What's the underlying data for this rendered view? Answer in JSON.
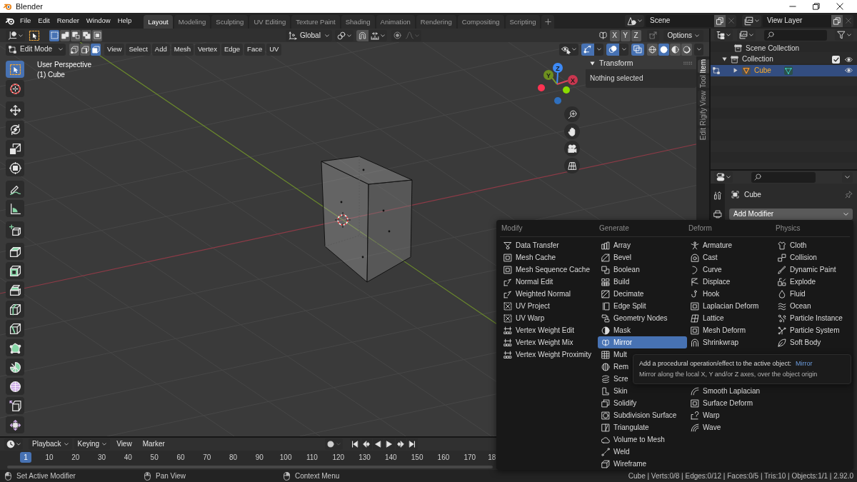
{
  "window": {
    "title": "Blender"
  },
  "top_bar": {
    "menus": [
      "File",
      "Edit",
      "Render",
      "Window",
      "Help"
    ],
    "workspaces": [
      {
        "label": "Layout",
        "selected": true
      },
      {
        "label": "Modeling",
        "selected": false
      },
      {
        "label": "Sculpting",
        "selected": false
      },
      {
        "label": "UV Editing",
        "selected": false
      },
      {
        "label": "Texture Paint",
        "selected": false
      },
      {
        "label": "Shading",
        "selected": false
      },
      {
        "label": "Animation",
        "selected": false
      },
      {
        "label": "Rendering",
        "selected": false
      },
      {
        "label": "Compositing",
        "selected": false
      },
      {
        "label": "Scripting",
        "selected": false
      }
    ],
    "scene": "Scene",
    "view_layer": "View Layer"
  },
  "viewport": {
    "select_modes": [
      {
        "kind": "set",
        "selected": true
      },
      {
        "kind": "extend",
        "selected": false
      },
      {
        "kind": "subtract",
        "selected": false
      },
      {
        "kind": "difference",
        "selected": false
      },
      {
        "kind": "intersect",
        "selected": false
      }
    ],
    "orientation": "Global",
    "mirror_axes": [
      {
        "label": "X",
        "selected": false
      },
      {
        "label": "Y",
        "selected": false
      },
      {
        "label": "Z",
        "selected": false
      }
    ],
    "options": "Options",
    "mode": "Edit Mode",
    "element_modes": [
      {
        "kind": "vertex",
        "selected": false
      },
      {
        "kind": "edge",
        "selected": false
      },
      {
        "kind": "face",
        "selected": true
      }
    ],
    "menus": [
      "View",
      "Select",
      "Add",
      "Mesh",
      "Vertex",
      "Edge",
      "Face",
      "UV"
    ],
    "display_toggles": [
      {
        "kind": "gizmo",
        "on": true
      },
      {
        "kind": "overlay",
        "on": true
      },
      {
        "kind": "xray",
        "on": true
      }
    ],
    "shading_modes": [
      {
        "kind": "wireframe",
        "selected": false
      },
      {
        "kind": "solid",
        "selected": true
      },
      {
        "kind": "material",
        "selected": false
      },
      {
        "kind": "rendered",
        "selected": false
      }
    ],
    "view_name": "User Perspective",
    "object_label": "(1) Cube",
    "tool_groups": [
      [
        {
          "kind": "select",
          "selected": true
        },
        {
          "kind": "cursor",
          "selected": false
        }
      ],
      [
        {
          "kind": "move",
          "selected": false
        },
        {
          "kind": "rotate",
          "selected": false
        },
        {
          "kind": "scale",
          "selected": false
        },
        {
          "kind": "transform",
          "selected": false
        }
      ],
      [
        {
          "kind": "annotate",
          "selected": false
        },
        {
          "kind": "measure",
          "selected": false
        }
      ],
      [
        {
          "kind": "addcube",
          "selected": false
        }
      ],
      [
        {
          "kind": "extrude",
          "selected": false
        },
        {
          "kind": "inset",
          "selected": false
        },
        {
          "kind": "bevel",
          "selected": false
        },
        {
          "kind": "loopcut",
          "selected": false
        },
        {
          "kind": "knife",
          "selected": false
        },
        {
          "kind": "polybuild",
          "selected": false
        },
        {
          "kind": "spin",
          "selected": false
        },
        {
          "kind": "smooth",
          "selected": false
        },
        {
          "kind": "slide",
          "selected": false
        },
        {
          "kind": "shrink",
          "selected": false
        }
      ]
    ],
    "navigation_gizmo": {
      "x": "X",
      "y": "Y",
      "z": "Z"
    },
    "sidebar": {
      "panel": {
        "title": "Transform",
        "expanded": true,
        "text": "Nothing selected"
      },
      "tabs": [
        {
          "label": "Item",
          "selected": true
        },
        {
          "label": "Tool",
          "selected": false
        },
        {
          "label": "View",
          "selected": false
        },
        {
          "label": "Rigify",
          "selected": false
        },
        {
          "label": "Edit",
          "selected": false
        }
      ]
    }
  },
  "outliner": {
    "tree": [
      {
        "label": "Scene Collection",
        "kind": "scene",
        "selected": false,
        "children": [
          {
            "label": "Collection",
            "kind": "collection",
            "selected": false,
            "expanded": true,
            "checked": true,
            "children": [
              {
                "label": "Cube",
                "kind": "object",
                "selected": true,
                "expanded": false
              }
            ]
          }
        ]
      }
    ]
  },
  "properties": {
    "object_name": "Cube",
    "add_modifier": "Add Modifier"
  },
  "modifier_menu": {
    "columns": [
      {
        "header": "Modify",
        "items": [
          {
            "label": "Data Transfer",
            "kind": "transfer",
            "selected": false
          },
          {
            "label": "Mesh Cache",
            "kind": "frame",
            "selected": false
          },
          {
            "label": "Mesh Sequence Cache",
            "kind": "frame",
            "selected": false
          },
          {
            "label": "Normal Edit",
            "kind": "normal",
            "selected": false
          },
          {
            "label": "Weighted Normal",
            "kind": "normal",
            "selected": false
          },
          {
            "label": "UV Project",
            "kind": "uv",
            "selected": false
          },
          {
            "label": "UV Warp",
            "kind": "uv",
            "selected": false
          },
          {
            "label": "Vertex Weight Edit",
            "kind": "weight",
            "selected": false
          },
          {
            "label": "Vertex Weight Mix",
            "kind": "weight",
            "selected": false
          },
          {
            "label": "Vertex Weight Proximity",
            "kind": "weight",
            "selected": false
          }
        ]
      },
      {
        "header": "Generate",
        "items": [
          {
            "label": "Array",
            "kind": "array",
            "selected": false
          },
          {
            "label": "Bevel",
            "kind": "bevel",
            "selected": false
          },
          {
            "label": "Boolean",
            "kind": "boolean",
            "selected": false
          },
          {
            "label": "Build",
            "kind": "build",
            "selected": false
          },
          {
            "label": "Decimate",
            "kind": "decimate",
            "selected": false
          },
          {
            "label": "Edge Split",
            "kind": "split",
            "selected": false
          },
          {
            "label": "Geometry Nodes",
            "kind": "nodes",
            "selected": false
          },
          {
            "label": "Mask",
            "kind": "mask",
            "selected": false
          },
          {
            "label": "Mirror",
            "kind": "mirror",
            "selected": true
          },
          {
            "label": "Mult",
            "kind": "multires",
            "selected": false
          },
          {
            "label": "Rem",
            "kind": "remesh",
            "selected": false
          },
          {
            "label": "Scre",
            "kind": "screw",
            "selected": false
          },
          {
            "label": "Skin",
            "kind": "skin",
            "selected": false
          },
          {
            "label": "Solidify",
            "kind": "solidify",
            "selected": false
          },
          {
            "label": "Subdivision Surface",
            "kind": "subdivision",
            "selected": false
          },
          {
            "label": "Triangulate",
            "kind": "triangulate",
            "selected": false
          },
          {
            "label": "Volume to Mesh",
            "kind": "volume",
            "selected": false
          },
          {
            "label": "Weld",
            "kind": "weld",
            "selected": false
          },
          {
            "label": "Wireframe",
            "kind": "wireframe",
            "selected": false
          }
        ]
      },
      {
        "header": "Deform",
        "items": [
          {
            "label": "Armature",
            "kind": "armature",
            "selected": false
          },
          {
            "label": "Cast",
            "kind": "cast",
            "selected": false
          },
          {
            "label": "Curve",
            "kind": "curve",
            "selected": false
          },
          {
            "label": "Displace",
            "kind": "displace",
            "selected": false
          },
          {
            "label": "Hook",
            "kind": "hook",
            "selected": false
          },
          {
            "label": "Laplacian Deform",
            "kind": "frame",
            "selected": false
          },
          {
            "label": "Lattice",
            "kind": "lattice",
            "selected": false
          },
          {
            "label": "Mesh Deform",
            "kind": "frame",
            "selected": false
          },
          {
            "label": "Shrinkwrap",
            "kind": "shrinkwrap",
            "selected": false
          }
        ],
        "items_below_tooltip": [
          {
            "label": "Smooth Laplacian",
            "kind": "smooth",
            "selected": false
          },
          {
            "label": "Surface Deform",
            "kind": "frame",
            "selected": false
          },
          {
            "label": "Warp",
            "kind": "warp",
            "selected": false
          },
          {
            "label": "Wave",
            "kind": "wave",
            "selected": false
          }
        ]
      },
      {
        "header": "Physics",
        "items": [
          {
            "label": "Cloth",
            "kind": "cloth",
            "selected": false
          },
          {
            "label": "Collision",
            "kind": "collision",
            "selected": false
          },
          {
            "label": "Dynamic Paint",
            "kind": "paint",
            "selected": false
          },
          {
            "label": "Explode",
            "kind": "explode",
            "selected": false
          },
          {
            "label": "Fluid",
            "kind": "fluid",
            "selected": false
          },
          {
            "label": "Ocean",
            "kind": "ocean",
            "selected": false
          },
          {
            "label": "Particle Instance",
            "kind": "instance",
            "selected": false
          },
          {
            "label": "Particle System",
            "kind": "particles",
            "selected": false
          },
          {
            "label": "Soft Body",
            "kind": "softbody",
            "selected": false
          }
        ]
      }
    ],
    "tooltip": {
      "text": "Add a procedural operation/effect to the active object:",
      "operator": "Mirror",
      "description": "Mirror along the local X, Y and/or Z axes, over the object origin"
    }
  },
  "timeline": {
    "menus": [
      {
        "label": "Playback",
        "kind": "dropdown"
      },
      {
        "label": "Keying",
        "kind": "dropdown"
      },
      {
        "label": "View",
        "kind": "menu"
      },
      {
        "label": "Marker",
        "kind": "menu"
      }
    ],
    "frames": [
      {
        "label": "1",
        "selected": true
      },
      {
        "label": "10",
        "selected": false
      },
      {
        "label": "20",
        "selected": false
      },
      {
        "label": "30",
        "selected": false
      },
      {
        "label": "40",
        "selected": false
      },
      {
        "label": "50",
        "selected": false
      },
      {
        "label": "60",
        "selected": false
      },
      {
        "label": "70",
        "selected": false
      },
      {
        "label": "80",
        "selected": false
      },
      {
        "label": "90",
        "selected": false
      },
      {
        "label": "100",
        "selected": false
      },
      {
        "label": "110",
        "selected": false
      },
      {
        "label": "120",
        "selected": false
      },
      {
        "label": "130",
        "selected": false
      },
      {
        "label": "140",
        "selected": false
      },
      {
        "label": "150",
        "selected": false
      },
      {
        "label": "160",
        "selected": false
      },
      {
        "label": "170",
        "selected": false
      },
      {
        "label": "18",
        "selected": false
      }
    ]
  },
  "status_bar": {
    "hints": [
      {
        "kind": "left",
        "text": "Set Active Modifier"
      },
      {
        "kind": "middle",
        "text": "Pan View"
      },
      {
        "kind": "right",
        "text": "Context Menu"
      }
    ],
    "stats": "Cube | Verts:0/8 | Edges:0/12 | Faces:0/5 | Tris:10 | Objects:1/1 | 2.92.0"
  }
}
